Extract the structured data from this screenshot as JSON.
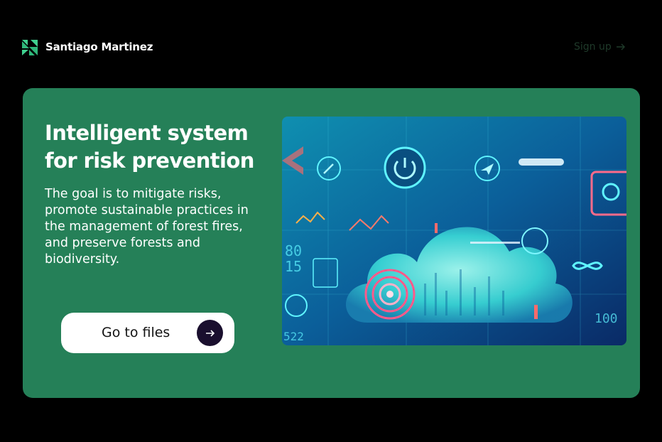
{
  "header": {
    "brand_name": "Santiago Martinez",
    "signup_label": "Sign up",
    "logo_icon": "brand-logo-icon",
    "signup_icon": "arrow-right-icon"
  },
  "hero_card": {
    "title": "Intelligent system for risk prevention",
    "description": "The goal is to mitigate risks, promote sustainable practices in the management of forest fires, and preserve forests and biodiversity.",
    "cta_label": "Go to files",
    "cta_icon": "arrow-right-icon",
    "card_color": "#258058",
    "image_icon": "cloud-technology-illustration"
  }
}
